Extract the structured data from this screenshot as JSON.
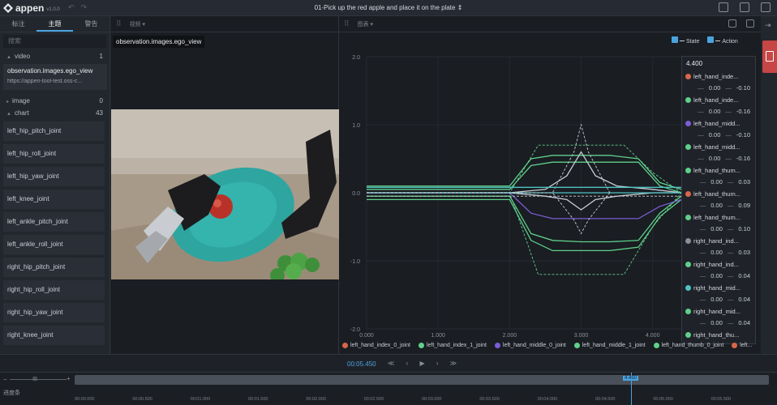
{
  "app": {
    "brand": "appen",
    "version": "v1.0.0",
    "task_title": "01-Pick up the red apple and place it on the plate ⇕"
  },
  "left_panel": {
    "tabs": [
      "标注",
      "主题",
      "警告"
    ],
    "search_placeholder": "搜索",
    "groups": [
      {
        "name": "video",
        "count": "1"
      },
      {
        "name": "image",
        "count": "0"
      },
      {
        "name": "chart",
        "count": "43"
      }
    ],
    "video_item": {
      "title": "observation.images.ego_view",
      "url": "https://appen-tool-test.oss-c..."
    },
    "joints": [
      "left_hip_pitch_joint",
      "left_hip_roll_joint",
      "left_hip_yaw_joint",
      "left_knee_joint",
      "left_ankle_pitch_joint",
      "left_ankle_roll_joint",
      "right_hip_pitch_joint",
      "right_hip_roll_joint",
      "right_hip_yaw_joint",
      "right_knee_joint"
    ]
  },
  "video_panel": {
    "header_label": "视频 ▾",
    "video_label": "observation.images.ego_view"
  },
  "chart_panel": {
    "header_label": "图表 ▾",
    "legend_top": [
      "State",
      "Action"
    ],
    "tooltip_time": "4.400",
    "tooltip_items": [
      {
        "name": "left_hand_inde...",
        "color": "#d9664a",
        "v1": "0.00",
        "v2": "-0.10"
      },
      {
        "name": "left_hand_inde...",
        "color": "#5fd08a",
        "v1": "0.00",
        "v2": "-0.16"
      },
      {
        "name": "left_hand_midd...",
        "color": "#7b5cd6",
        "v1": "0.00",
        "v2": "-0.10"
      },
      {
        "name": "left_hand_midd...",
        "color": "#5fd08a",
        "v1": "0.00",
        "v2": "-0.16"
      },
      {
        "name": "left_hand_thum...",
        "color": "#5fd08a",
        "v1": "0.00",
        "v2": "0.03"
      },
      {
        "name": "left_hand_thum...",
        "color": "#d9664a",
        "v1": "0.00",
        "v2": "0.09"
      },
      {
        "name": "left_hand_thum...",
        "color": "#5fd08a",
        "v1": "0.00",
        "v2": "0.10"
      },
      {
        "name": "right_hand_ind...",
        "color": "#8a8f96",
        "v1": "0.00",
        "v2": "0.03"
      },
      {
        "name": "right_hand_ind...",
        "color": "#5fd08a",
        "v1": "0.00",
        "v2": "0.04"
      },
      {
        "name": "right_hand_mid...",
        "color": "#4ec3c3",
        "v1": "0.00",
        "v2": "0.04"
      },
      {
        "name": "right_hand_mid...",
        "color": "#5fd08a",
        "v1": "0.00",
        "v2": "0.04"
      },
      {
        "name": "right_hand_thu...",
        "color": "#5fd08a",
        "v1": "0.00",
        "v2": "0.04"
      }
    ],
    "legend_bottom": [
      {
        "name": "left_hand_index_0_joint",
        "color": "#d9664a"
      },
      {
        "name": "left_hand_index_1_joint",
        "color": "#5fd08a"
      },
      {
        "name": "left_hand_middle_0_joint",
        "color": "#7b5cd6"
      },
      {
        "name": "left_hand_middle_1_joint",
        "color": "#5fd08a"
      },
      {
        "name": "left_hand_thumb_0_joint",
        "color": "#5fd08a"
      },
      {
        "name": "left...",
        "color": "#d9664a"
      }
    ]
  },
  "chart_data": {
    "type": "line",
    "xlim": [
      0,
      4.4
    ],
    "ylim": [
      -2.0,
      2.0
    ],
    "x_ticks": [
      "0.000",
      "1.000",
      "2.000",
      "3.000",
      "4.000"
    ],
    "y_ticks": [
      "2.0",
      "1.0",
      "0.0",
      "-1.0",
      "-2.0"
    ],
    "grid": true,
    "series": [
      {
        "color": "#5fd08a",
        "style": "solid",
        "x": [
          0,
          2.0,
          2.3,
          2.6,
          3.0,
          3.4,
          3.8,
          4.1,
          4.4
        ],
        "y": [
          0.05,
          0.05,
          0.4,
          0.45,
          0.45,
          0.45,
          0.45,
          0.1,
          0.0
        ]
      },
      {
        "color": "#5fd08a",
        "style": "solid",
        "x": [
          0,
          2.0,
          2.3,
          2.6,
          3.0,
          3.4,
          3.8,
          4.1,
          4.4
        ],
        "y": [
          0.1,
          0.1,
          0.5,
          0.55,
          0.55,
          0.55,
          0.5,
          0.15,
          0.05
        ]
      },
      {
        "color": "#5fd08a",
        "style": "solid",
        "x": [
          0,
          2.0,
          2.3,
          2.6,
          3.0,
          3.4,
          3.8,
          4.1,
          4.4
        ],
        "y": [
          -0.05,
          -0.05,
          -0.6,
          -0.7,
          -0.72,
          -0.72,
          -0.7,
          -0.3,
          -0.05
        ]
      },
      {
        "color": "#5fd08a",
        "style": "solid",
        "x": [
          0,
          2.0,
          2.3,
          2.6,
          3.0,
          3.4,
          3.8,
          4.1,
          4.4
        ],
        "y": [
          -0.1,
          -0.1,
          -0.7,
          -0.85,
          -0.85,
          -0.85,
          -0.8,
          -0.35,
          -0.1
        ]
      },
      {
        "color": "#7b5cd6",
        "style": "solid",
        "x": [
          0,
          2.0,
          2.3,
          2.6,
          3.0,
          3.4,
          3.8,
          4.1,
          4.4
        ],
        "y": [
          0.0,
          0.0,
          -0.3,
          -0.38,
          -0.38,
          -0.38,
          -0.38,
          -0.2,
          -0.1
        ]
      },
      {
        "color": "#c9ced6",
        "style": "solid",
        "x": [
          0,
          2.0,
          2.5,
          2.8,
          3.0,
          3.2,
          3.5,
          4.0,
          4.4
        ],
        "y": [
          0.0,
          0.0,
          0.05,
          0.25,
          0.6,
          0.25,
          0.1,
          0.05,
          0.0
        ]
      },
      {
        "color": "#c9ced6",
        "style": "solid",
        "x": [
          0,
          2.0,
          2.5,
          2.8,
          3.0,
          3.2,
          3.5,
          4.0,
          4.4
        ],
        "y": [
          0.0,
          0.0,
          -0.05,
          -0.1,
          -0.25,
          -0.1,
          -0.05,
          0.0,
          0.0
        ]
      },
      {
        "color": "#4ec3c3",
        "style": "solid",
        "x": [
          0,
          2.0,
          2.5,
          3.0,
          3.5,
          4.0,
          4.4
        ],
        "y": [
          0.0,
          0.0,
          0.0,
          0.0,
          0.0,
          0.0,
          0.0
        ]
      },
      {
        "color": "#5fd08a",
        "style": "dashed",
        "x": [
          0,
          2.0,
          2.4,
          3.0,
          3.6,
          4.0,
          4.4
        ],
        "y": [
          0.0,
          0.0,
          0.7,
          0.7,
          0.7,
          0.3,
          0.0
        ]
      },
      {
        "color": "#5fd08a",
        "style": "dashed",
        "x": [
          0,
          2.0,
          2.4,
          3.0,
          3.6,
          4.0,
          4.4
        ],
        "y": [
          0.0,
          0.0,
          -1.2,
          -1.2,
          -1.2,
          -0.5,
          0.0
        ]
      },
      {
        "color": "#c9ced6",
        "style": "dashed",
        "x": [
          0,
          2.6,
          2.9,
          3.0,
          3.1,
          3.4
        ],
        "y": [
          0.0,
          0.0,
          0.6,
          1.0,
          0.6,
          0.0
        ]
      },
      {
        "color": "#c9ced6",
        "style": "dashed",
        "x": [
          0,
          2.6,
          2.9,
          3.0,
          3.1,
          3.4
        ],
        "y": [
          0.0,
          0.0,
          -0.4,
          -0.6,
          -0.4,
          0.0
        ]
      },
      {
        "color": "#c9ced6",
        "style": "dashed",
        "x": [
          0,
          4.4
        ],
        "y": [
          -0.05,
          -0.05
        ]
      },
      {
        "color": "#4ec3c3",
        "style": "solid",
        "x": [
          0,
          4.4
        ],
        "y": [
          0.08,
          0.08
        ]
      }
    ]
  },
  "playbar": {
    "time": "00:05.450",
    "controls": "≪ ‹ ▶ › ≫"
  },
  "timeline": {
    "zoom_minus": "−",
    "zoom_label": "缩",
    "zoom_plus": "+",
    "progress_label": "进度条",
    "playhead_label": "4.450",
    "ticks": [
      "00:00.000",
      "00:00.500",
      "00:01.000",
      "00:01.500",
      "00:02.000",
      "00:02.500",
      "00:03.000",
      "00:03.500",
      "00:04.000",
      "00:04.500",
      "00:05.000",
      "00:05.500"
    ]
  }
}
